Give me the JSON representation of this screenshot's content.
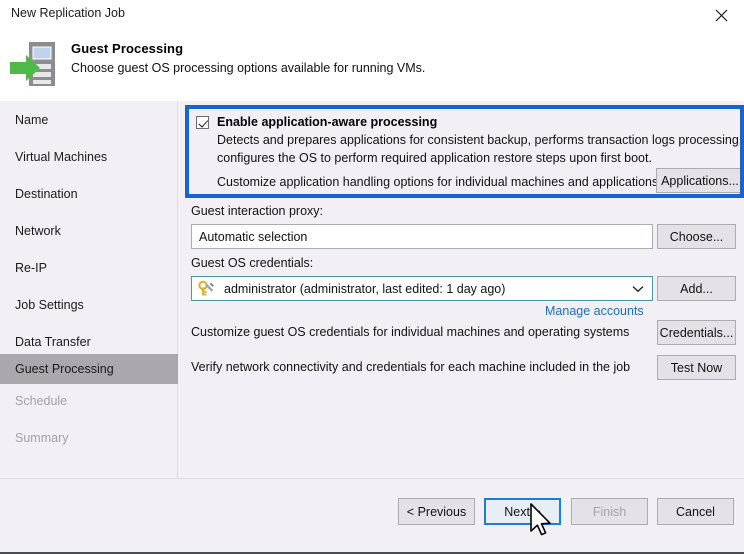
{
  "window": {
    "title": "New Replication Job",
    "close_icon": "close-icon"
  },
  "header": {
    "title": "Guest Processing",
    "subtitle": "Choose guest OS processing options available for running VMs.",
    "icon": "replication-job-icon"
  },
  "sidebar": {
    "items": [
      {
        "label": "Name",
        "state": "enabled"
      },
      {
        "label": "Virtual Machines",
        "state": "enabled"
      },
      {
        "label": "Destination",
        "state": "enabled"
      },
      {
        "label": "Network",
        "state": "enabled"
      },
      {
        "label": "Re-IP",
        "state": "enabled"
      },
      {
        "label": "Job Settings",
        "state": "enabled"
      },
      {
        "label": "Data Transfer",
        "state": "enabled"
      },
      {
        "label": "Guest Processing",
        "state": "selected"
      },
      {
        "label": "Schedule",
        "state": "disabled"
      },
      {
        "label": "Summary",
        "state": "disabled"
      }
    ]
  },
  "content": {
    "app_aware": {
      "checkbox_label": "Enable application-aware processing",
      "checked": true,
      "description_line1": "Detects and prepares applications for consistent backup, performs transaction logs processing, and",
      "description_line2": "configures the OS to perform required application restore steps upon first boot.",
      "customize_text": "Customize application handling options for individual machines and applications",
      "applications_button": "Applications...",
      "highlight_color": "#1464d2"
    },
    "guest_interaction_proxy": {
      "label": "Guest interaction proxy:",
      "value": "Automatic selection",
      "choose_button": "Choose..."
    },
    "guest_os_credentials": {
      "label": "Guest OS credentials:",
      "value": "administrator (administrator, last edited: 1 day ago)",
      "icon": "key-icon",
      "add_button": "Add...",
      "manage_accounts_link": "Manage accounts",
      "link_color": "#1b6fc4"
    },
    "credentials_row": {
      "text": "Customize guest OS credentials for individual machines and operating systems",
      "button": "Credentials..."
    },
    "test_row": {
      "text": "Verify network connectivity and credentials for each machine included in the job",
      "button": "Test Now"
    }
  },
  "footer": {
    "previous_button": "< Previous",
    "next_button": "Next >",
    "finish_button": "Finish",
    "cancel_button": "Cancel",
    "finish_enabled": false,
    "next_focused": true
  }
}
